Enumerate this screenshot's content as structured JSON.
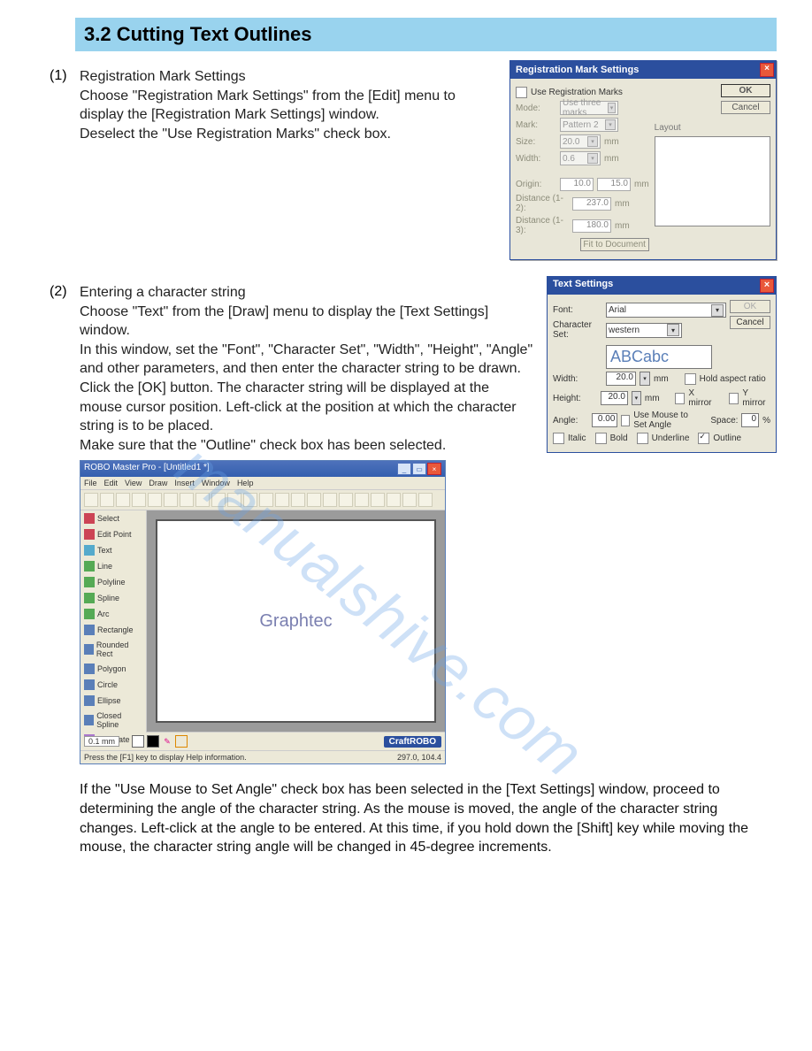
{
  "section_header": "3.2  Cutting Text Outlines",
  "watermark": "manualshive.com",
  "step1": {
    "num": "(1)",
    "title": "Registration Mark Settings",
    "text": "Choose \"Registration Mark Settings\" from the [Edit] menu to display the [Registration Mark Settings] window.\nDeselect the \"Use Registration Marks\" check box."
  },
  "dlg1": {
    "title": "Registration Mark Settings",
    "use_label": "Use Registration Marks",
    "mode_label": "Mode:",
    "mode_value": "Use three marks",
    "mark_label": "Mark:",
    "mark_value": "Pattern 2",
    "size_label": "Size:",
    "size_value": "20.0",
    "mm": "mm",
    "width_label": "Width:",
    "width_value": "0.6",
    "origin_label": "Origin:",
    "origin_x": "10.0",
    "origin_y": "15.0",
    "dist12_label": "Distance (1-2):",
    "dist12_value": "237.0",
    "dist13_label": "Distance (1-3):",
    "dist13_value": "180.0",
    "fit_btn": "Fit to Document",
    "layout_label": "Layout",
    "ok": "OK",
    "cancel": "Cancel"
  },
  "step2": {
    "num": "(2)",
    "title": "Entering a character string",
    "text": "Choose \"Text\" from the [Draw] menu to display the [Text Settings] window.\nIn this window, set the \"Font\", \"Character Set\", \"Width\", \"Height\", \"Angle\" and other parameters, and then enter the character string to be drawn. Click the [OK] button. The character string will be displayed at the mouse cursor position. Left-click at the position at which the character string is to be placed.\nMake sure that the \"Outline\" check box has been selected."
  },
  "dlg2": {
    "title": "Text Settings",
    "font_label": "Font:",
    "font_value": "Arial",
    "cset_label": "Character Set:",
    "cset_value": "western",
    "sample": "ABCabc",
    "width_label": "Width:",
    "width_value": "20.0",
    "height_label": "Height:",
    "height_value": "20.0",
    "mm": "mm",
    "hold_label": "Hold aspect ratio",
    "xmirror_label": "X mirror",
    "ymirror_label": "Y mirror",
    "angle_label": "Angle:",
    "angle_value": "0.00",
    "mouse_angle_label": "Use Mouse to Set Angle",
    "space_label": "Space:",
    "space_value": "0",
    "pct": "%",
    "italic_label": "Italic",
    "bold_label": "Bold",
    "underline_label": "Underline",
    "outline_label": "Outline",
    "ok": "OK",
    "cancel": "Cancel"
  },
  "editor": {
    "title": "ROBO Master Pro - [Untitled1 *]",
    "menus": [
      "File",
      "Edit",
      "View",
      "Draw",
      "Insert",
      "Window",
      "Help"
    ],
    "canvas_text": "Graphtec",
    "status_left": "Press the [F1] key to display Help information.",
    "status_right": "297.0, 104.4",
    "brand": "CraftROBO",
    "swatches": [
      "#ffffff",
      "#000000",
      "#000000"
    ],
    "side_buttons": [
      "0.1 mm"
    ],
    "tools": [
      {
        "label": "Select",
        "color": "#cc4455"
      },
      {
        "label": "Edit Point",
        "color": "#cc4455"
      },
      {
        "label": "Text",
        "color": "#55aacc"
      },
      {
        "label": "Line",
        "color": "#55aa55"
      },
      {
        "label": "Polyline",
        "color": "#55aa55"
      },
      {
        "label": "Spline",
        "color": "#55aa55"
      },
      {
        "label": "Arc",
        "color": "#55aa55"
      },
      {
        "label": "Rectangle",
        "color": "#5a7fb8"
      },
      {
        "label": "Rounded Rect",
        "color": "#5a7fb8"
      },
      {
        "label": "Polygon",
        "color": "#5a7fb8"
      },
      {
        "label": "Circle",
        "color": "#5a7fb8"
      },
      {
        "label": "Ellipse",
        "color": "#5a7fb8"
      },
      {
        "label": "Closed Spline",
        "color": "#5a7fb8"
      },
      {
        "label": "Template",
        "color": "#aa77cc"
      }
    ]
  },
  "trailing": "If the \"Use Mouse to Set Angle\" check box has been selected in the [Text Settings] window, proceed to determining the angle of the character string. As the mouse is moved, the angle of the character string changes. Left-click at the angle to be entered. At this time, if you hold down the [Shift] key while moving the mouse, the character string angle will be changed in 45-degree increments."
}
